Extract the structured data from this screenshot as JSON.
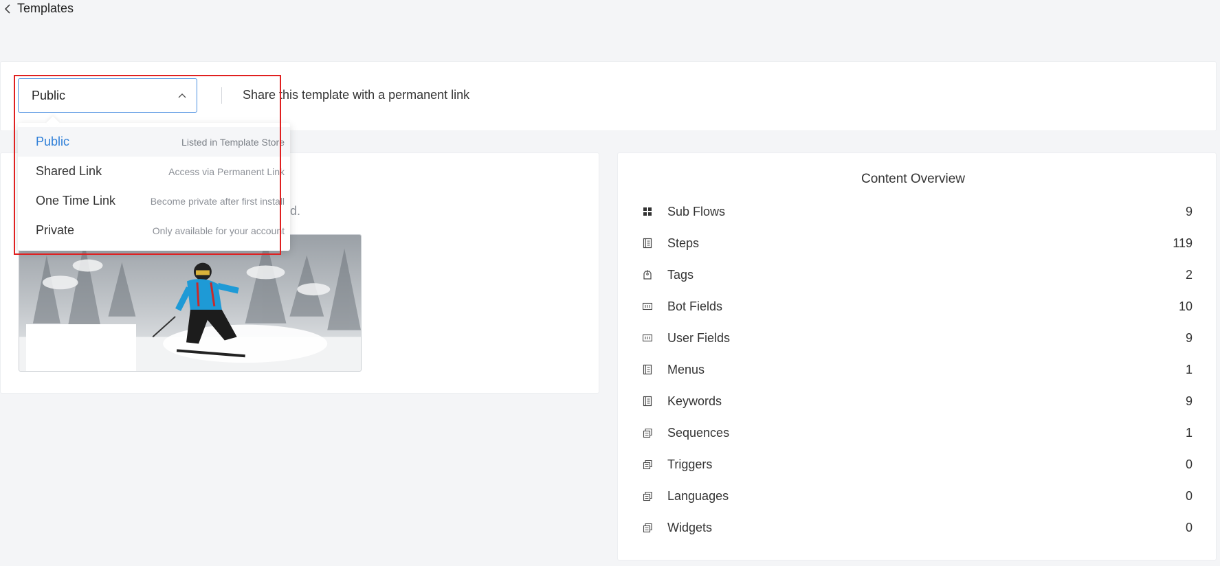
{
  "breadcrumb": {
    "label": "Templates"
  },
  "visibility": {
    "selected": "Public",
    "hint": "Share this template with a permanent link",
    "options": [
      {
        "name": "Public",
        "desc": "Listed in Template Store"
      },
      {
        "name": "Shared Link",
        "desc": "Access via Permanent Link"
      },
      {
        "name": "One Time Link",
        "desc": "Become private after first install"
      },
      {
        "name": "Private",
        "desc": "Only available for your account"
      }
    ]
  },
  "description_fragment": "d.",
  "content_overview": {
    "title": "Content Overview",
    "items": [
      {
        "label": "Sub Flows",
        "count": "9",
        "icon": "grid-icon"
      },
      {
        "label": "Steps",
        "count": "119",
        "icon": "document-icon"
      },
      {
        "label": "Tags",
        "count": "2",
        "icon": "tag-icon"
      },
      {
        "label": "Bot Fields",
        "count": "10",
        "icon": "field-icon"
      },
      {
        "label": "User Fields",
        "count": "9",
        "icon": "field-icon"
      },
      {
        "label": "Menus",
        "count": "1",
        "icon": "document-icon"
      },
      {
        "label": "Keywords",
        "count": "9",
        "icon": "document-icon"
      },
      {
        "label": "Sequences",
        "count": "1",
        "icon": "stack-icon"
      },
      {
        "label": "Triggers",
        "count": "0",
        "icon": "stack-icon"
      },
      {
        "label": "Languages",
        "count": "0",
        "icon": "stack-icon"
      },
      {
        "label": "Widgets",
        "count": "0",
        "icon": "stack-icon"
      }
    ]
  }
}
